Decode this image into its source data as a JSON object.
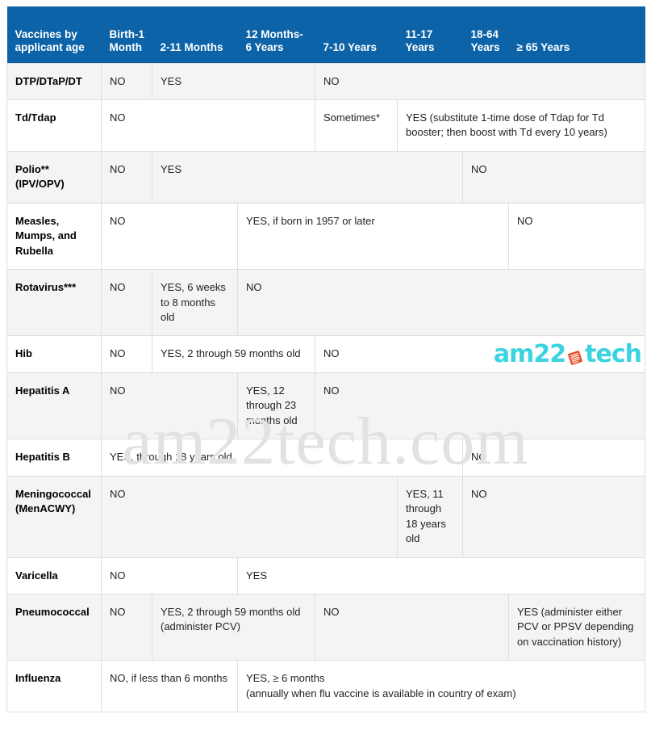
{
  "table": {
    "headers": [
      "Vaccines by applicant age",
      "Birth-1 Month",
      "2-11 Months",
      "12 Months-6 Years",
      "7-10 Years",
      "11-17 Years",
      "18-64 Years",
      "≥ 65 Years"
    ],
    "rows": [
      {
        "vaccine": "DTP/DTaP/DT",
        "cells": [
          {
            "text": "NO",
            "colspan": 1
          },
          {
            "text": "YES",
            "colspan": 2
          },
          {
            "text": "NO",
            "colspan": 4
          }
        ]
      },
      {
        "vaccine": "Td/Tdap",
        "cells": [
          {
            "text": "NO",
            "colspan": 3
          },
          {
            "text": "Sometimes*",
            "colspan": 1
          },
          {
            "text": "YES (substitute 1-time dose of Tdap for Td booster; then boost with Td every 10 years)",
            "colspan": 3
          }
        ]
      },
      {
        "vaccine": "Polio** (IPV/OPV)",
        "cells": [
          {
            "text": "NO",
            "colspan": 1
          },
          {
            "text": "YES",
            "colspan": 4
          },
          {
            "text": "NO",
            "colspan": 2
          }
        ]
      },
      {
        "vaccine": "Measles, Mumps, and Rubella",
        "cells": [
          {
            "text": "NO",
            "colspan": 2
          },
          {
            "text": "YES, if born in 1957 or later",
            "colspan": 4
          },
          {
            "text": "NO",
            "colspan": 1
          }
        ]
      },
      {
        "vaccine": "Rotavirus***",
        "cells": [
          {
            "text": "NO",
            "colspan": 1
          },
          {
            "text": "YES, 6 weeks to 8 months old",
            "colspan": 1
          },
          {
            "text": "NO",
            "colspan": 5
          }
        ]
      },
      {
        "vaccine": "Hib",
        "cells": [
          {
            "text": "NO",
            "colspan": 1
          },
          {
            "text": "YES, 2 through 59 months old",
            "colspan": 2
          },
          {
            "text": "NO",
            "colspan": 4
          }
        ]
      },
      {
        "vaccine": "Hepatitis A",
        "cells": [
          {
            "text": "NO",
            "colspan": 2
          },
          {
            "text": "YES, 12 through 23 months old",
            "colspan": 1
          },
          {
            "text": "NO",
            "colspan": 4
          }
        ]
      },
      {
        "vaccine": "Hepatitis B",
        "cells": [
          {
            "text": "YES, through 18 years old",
            "colspan": 5
          },
          {
            "text": "NO",
            "colspan": 2
          }
        ]
      },
      {
        "vaccine": "Meningococcal (MenACWY)",
        "cells": [
          {
            "text": "NO",
            "colspan": 4
          },
          {
            "text": "YES, 11 through 18 years old",
            "colspan": 1
          },
          {
            "text": "NO",
            "colspan": 2
          }
        ]
      },
      {
        "vaccine": "Varicella",
        "cells": [
          {
            "text": "NO",
            "colspan": 2
          },
          {
            "text": "YES",
            "colspan": 5
          }
        ]
      },
      {
        "vaccine": "Pneumococcal",
        "cells": [
          {
            "text": "NO",
            "colspan": 1
          },
          {
            "text": "YES, 2 through 59 months old (administer PCV)",
            "colspan": 2
          },
          {
            "text": "NO",
            "colspan": 3
          },
          {
            "text": "YES (administer either PCV or PPSV depending on vaccination history)",
            "colspan": 1
          }
        ]
      },
      {
        "vaccine": "Influenza",
        "cells": [
          {
            "text": "NO, if less than 6 months",
            "colspan": 2
          },
          {
            "text": "YES, ≥ 6 months\n(annually when flu vaccine is available in country of exam)",
            "colspan": 5
          }
        ]
      }
    ]
  },
  "branding": {
    "watermark": "am22tech.com",
    "logo_prefix": "am22",
    "logo_suffix": "tech",
    "logo_color": "#3ad3e0",
    "logo_mark_color": "#e8512a"
  },
  "colors": {
    "header_blue": "#0c63a8",
    "row_stripe": "#f2f2f2",
    "row_plain": "#ffffff",
    "border": "#dedede",
    "text": "#231f20",
    "watermark": "#e2e2e2"
  }
}
